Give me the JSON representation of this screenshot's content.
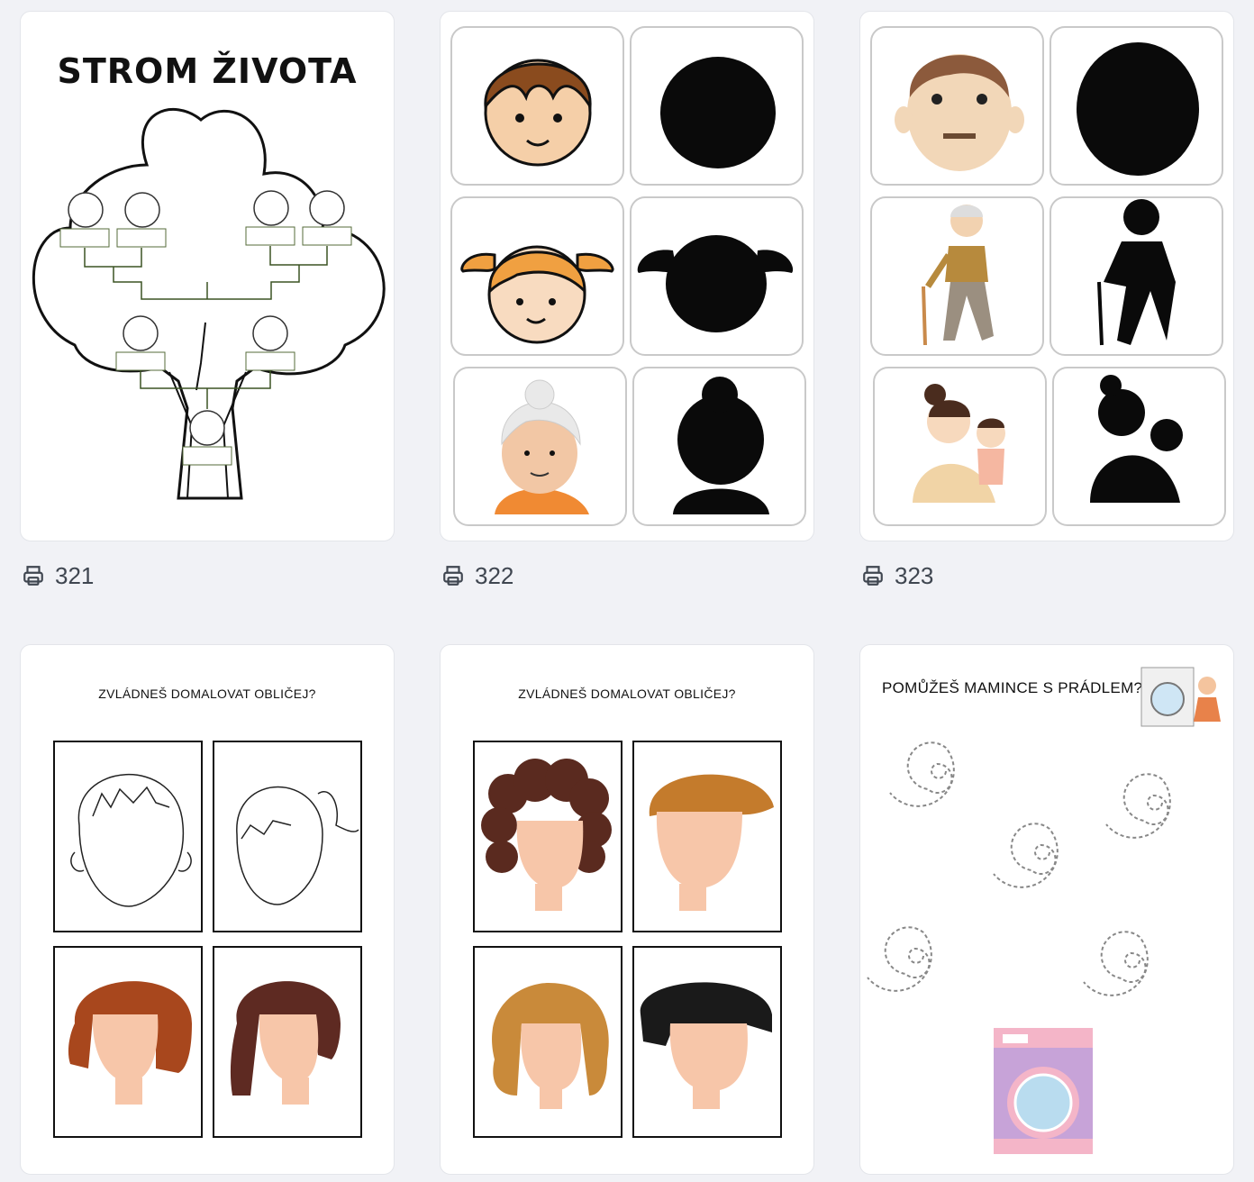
{
  "cards": [
    {
      "title": "STROM ŽIVOTA",
      "prints": "321"
    },
    {
      "title": "",
      "prints": "322"
    },
    {
      "title": "",
      "prints": "323"
    },
    {
      "title": "ZVLÁDNEŠ DOMALOVAT OBLIČEJ?",
      "prints": ""
    },
    {
      "title": "ZVLÁDNEŠ DOMALOVAT OBLIČEJ?",
      "prints": ""
    },
    {
      "title": "POMŮŽEŠ MAMINCE S PRÁDLEM?",
      "prints": ""
    }
  ],
  "icons": {
    "print": "printer-icon"
  },
  "colors": {
    "background": "#f1f2f6",
    "text": "#3f4650"
  }
}
